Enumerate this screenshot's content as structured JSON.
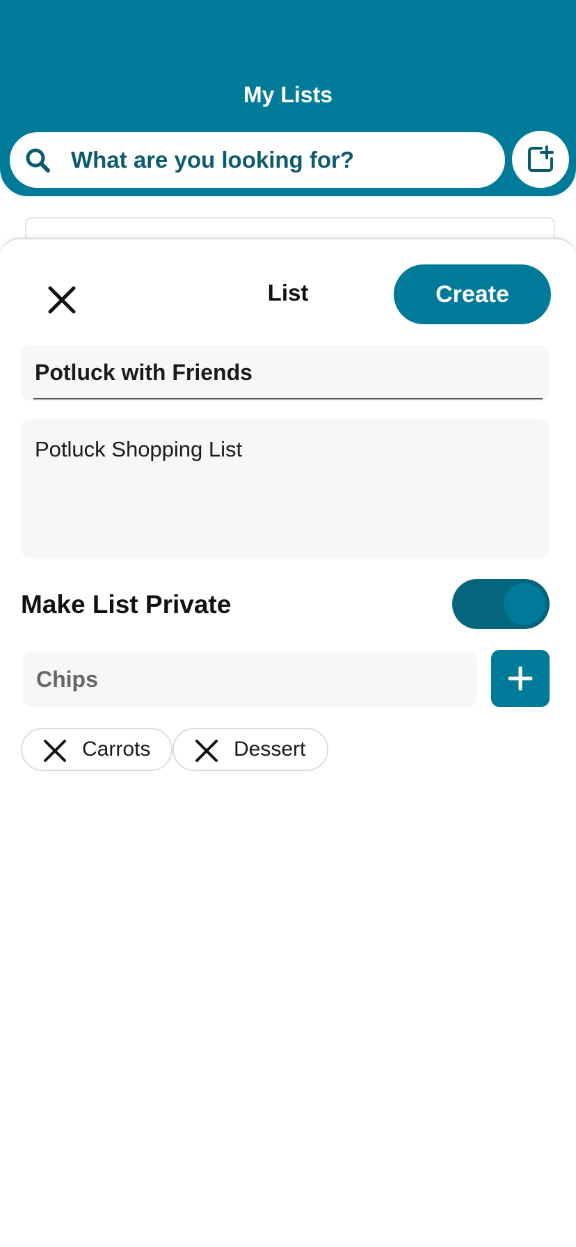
{
  "header": {
    "title": "My Lists",
    "search_placeholder": "What are you looking for?"
  },
  "sheet": {
    "title": "List",
    "create_label": "Create",
    "list_name": "Potluck with Friends",
    "list_description": "Potluck Shopping List",
    "private_label": "Make List Private",
    "private_enabled": true,
    "item_input_value": "Chips",
    "items": [
      "Carrots",
      "Dessert"
    ]
  },
  "colors": {
    "brand": "#007a99",
    "toggle_track": "#05657d",
    "search_text": "#0b5a6e",
    "field_bg": "#f7f7f5"
  },
  "icons": {
    "search": "search-icon",
    "add_list": "add-list-icon",
    "close": "close-icon",
    "plus": "plus-icon",
    "remove": "remove-icon"
  }
}
